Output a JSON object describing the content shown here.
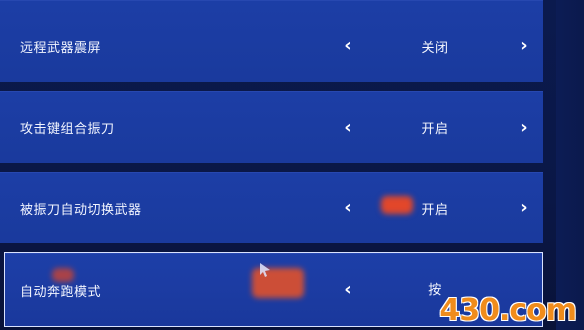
{
  "settings": [
    {
      "label": "远程武器震屏",
      "value": "关闭"
    },
    {
      "label": "攻击键组合振刀",
      "value": "开启"
    },
    {
      "label": "被振刀自动切换武器",
      "value": "开启"
    },
    {
      "label": "自动奔跑模式",
      "value": "按"
    }
  ],
  "watermark": {
    "logo": "430.com"
  },
  "colors": {
    "row_background": "#1c3ea6",
    "screen_background": "#0a1640",
    "selected_border": "#d9e2ff",
    "watermark": "#f08c1c"
  }
}
